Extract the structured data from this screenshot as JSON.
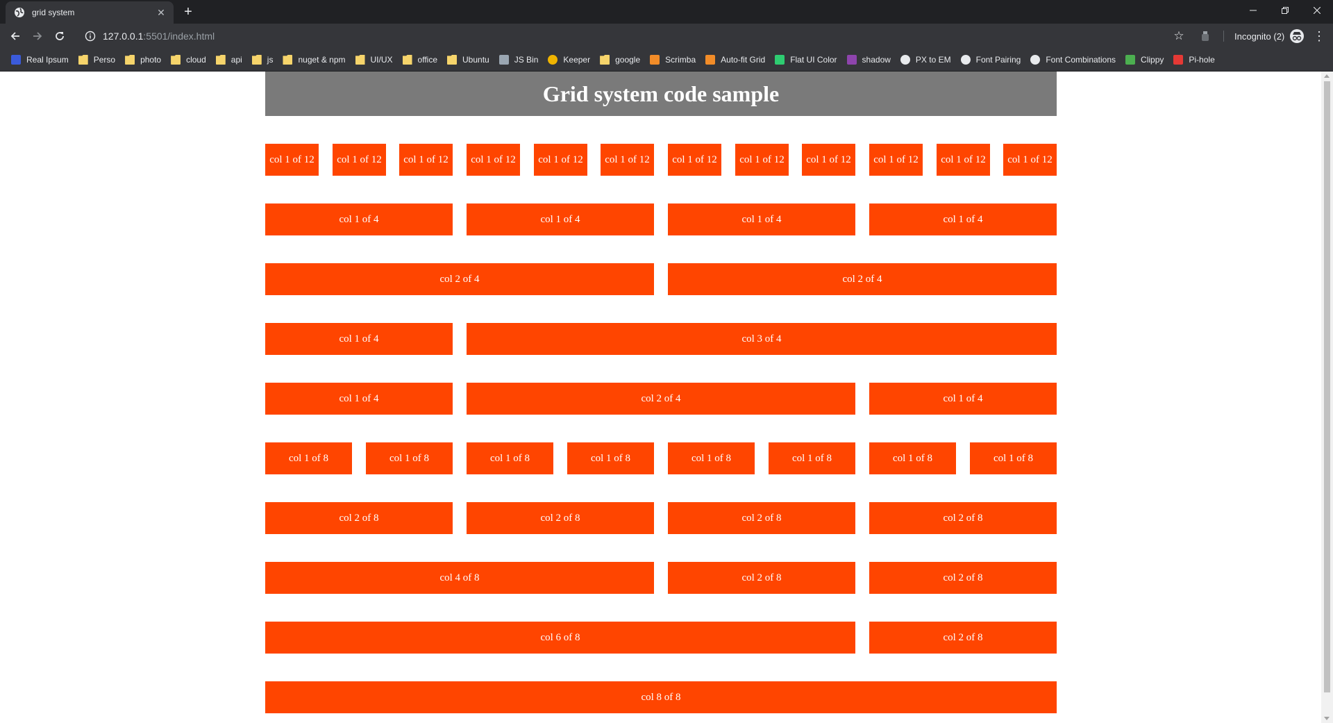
{
  "browser": {
    "tab_title": "grid system",
    "tab_close": "✕",
    "new_tab": "+",
    "url_host": "127.0.0.1",
    "url_rest": ":5501/index.html",
    "incognito_label": "Incognito (2)",
    "bookmarks": [
      {
        "label": "Real Ipsum",
        "icon": "real-ipsum-icon",
        "color": "#3b5bdb"
      },
      {
        "label": "Perso",
        "icon": "folder-icon",
        "color": "#f6d46b"
      },
      {
        "label": "photo",
        "icon": "folder-icon",
        "color": "#f6d46b"
      },
      {
        "label": "cloud",
        "icon": "folder-icon",
        "color": "#f6d46b"
      },
      {
        "label": "api",
        "icon": "folder-icon",
        "color": "#f6d46b"
      },
      {
        "label": "js",
        "icon": "folder-icon",
        "color": "#f6d46b"
      },
      {
        "label": "nuget & npm",
        "icon": "folder-icon",
        "color": "#f6d46b"
      },
      {
        "label": "UI/UX",
        "icon": "folder-icon",
        "color": "#f6d46b"
      },
      {
        "label": "office",
        "icon": "folder-icon",
        "color": "#f6d46b"
      },
      {
        "label": "Ubuntu",
        "icon": "folder-icon",
        "color": "#f6d46b"
      },
      {
        "label": "JS Bin",
        "icon": "jsbin-icon",
        "color": "#9aa6b2"
      },
      {
        "label": "Keeper",
        "icon": "keeper-icon",
        "color": "#f0b400"
      },
      {
        "label": "google",
        "icon": "folder-icon",
        "color": "#f6d46b"
      },
      {
        "label": "Scrimba",
        "icon": "scrimba-icon",
        "color": "#f28c28"
      },
      {
        "label": "Auto-fit Grid",
        "icon": "autofit-icon",
        "color": "#f28c28"
      },
      {
        "label": "Flat UI Color",
        "icon": "flatui-icon",
        "color": "#2ecc71"
      },
      {
        "label": "shadow",
        "icon": "shadow-icon",
        "color": "#8e44ad"
      },
      {
        "label": "PX to EM",
        "icon": "globe-icon",
        "color": "#e8eaed"
      },
      {
        "label": "Font Pairing",
        "icon": "font-pairing-icon",
        "color": "#e8eaed"
      },
      {
        "label": "Font Combinations",
        "icon": "globe-icon",
        "color": "#e8eaed"
      },
      {
        "label": "Clippy",
        "icon": "clippy-icon",
        "color": "#4caf50"
      },
      {
        "label": "Pi-hole",
        "icon": "pihole-icon",
        "color": "#e53935"
      }
    ]
  },
  "page": {
    "heading": "Grid system code sample",
    "header_bg": "#7a7a7a",
    "col_color": "#ff4500",
    "rows": [
      [
        "col 1 of 12",
        "col 1 of 12",
        "col 1 of 12",
        "col 1 of 12",
        "col 1 of 12",
        "col 1 of 12",
        "col 1 of 12",
        "col 1 of 12",
        "col 1 of 12",
        "col 1 of 12",
        "col 1 of 12",
        "col 1 of 12"
      ],
      [
        "col 1 of 4",
        "col 1 of 4",
        "col 1 of 4",
        "col 1 of 4"
      ],
      [
        "col 2 of 4",
        "col 2 of 4"
      ],
      [
        "col 1 of 4",
        "col 3 of 4"
      ],
      [
        "col 1 of 4",
        "col 2 of 4",
        "col 1 of 4"
      ],
      [
        "col 1 of 8",
        "col 1 of 8",
        "col 1 of 8",
        "col 1 of 8",
        "col 1 of 8",
        "col 1 of 8",
        "col 1 of 8",
        "col 1 of 8"
      ],
      [
        "col 2 of 8",
        "col 2 of 8",
        "col 2 of 8",
        "col 2 of 8"
      ],
      [
        "col 4 of 8",
        "col 2 of 8",
        "col 2 of 8"
      ],
      [
        "col 6 of 8",
        "col 2 of 8"
      ],
      [
        "col 8 of 8"
      ]
    ]
  }
}
